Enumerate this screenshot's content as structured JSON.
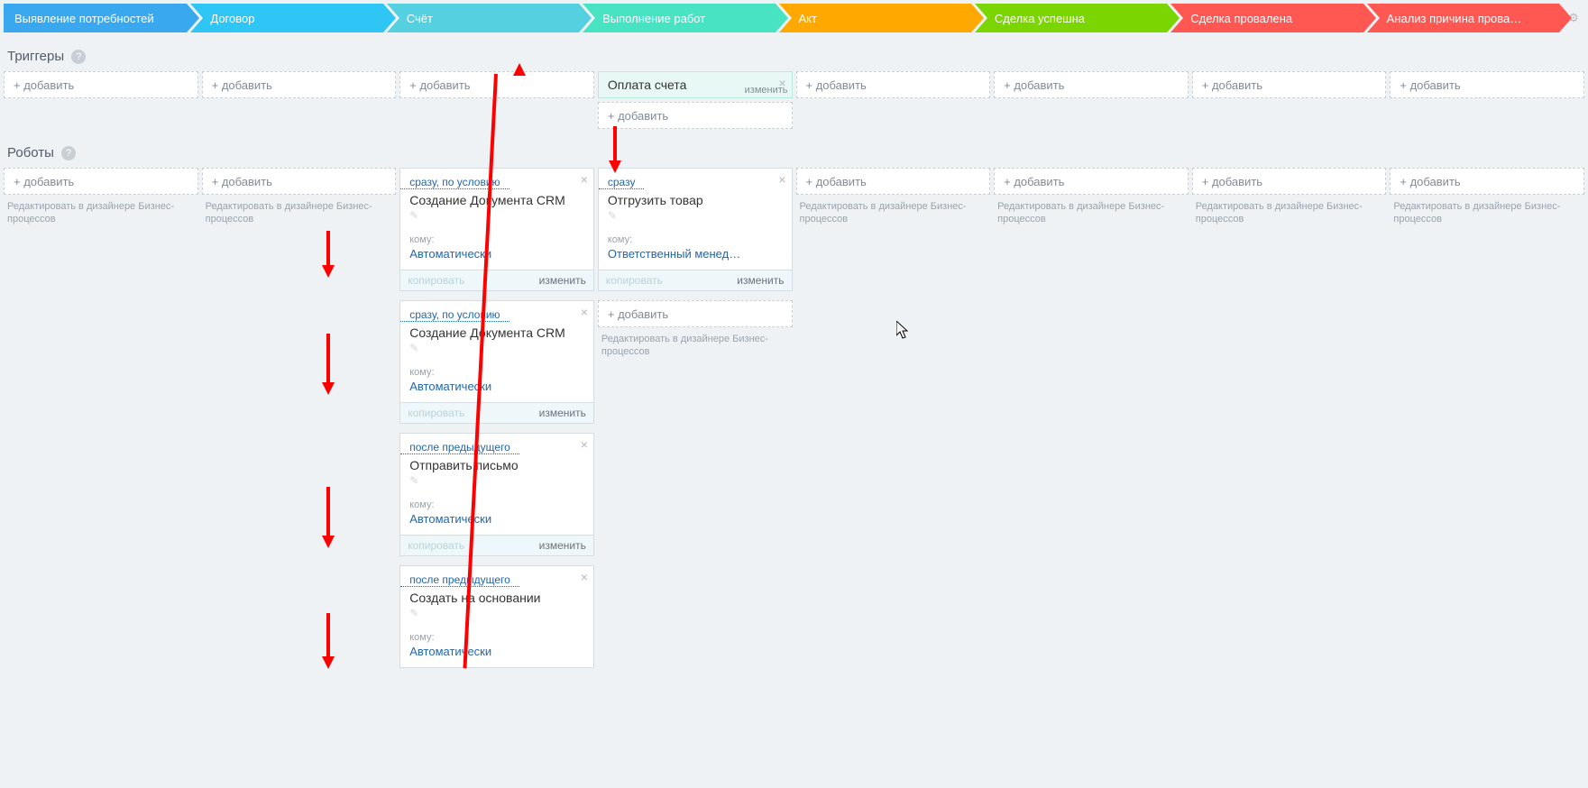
{
  "stages": [
    "Выявление потребностей",
    "Договор",
    "Счёт",
    "Выполнение работ",
    "Акт",
    "Сделка успешна",
    "Сделка провалена",
    "Анализ причина прова…"
  ],
  "labels": {
    "triggers": "Триггеры",
    "robots": "Роботы",
    "add": "+ добавить",
    "bp_edit": "Редактировать в дизайнере Бизнес-процессов",
    "edit": "изменить",
    "copy": "копировать",
    "who": "кому:",
    "auto": "Автоматически"
  },
  "triggers": {
    "col3": {
      "title": "Оплата счета"
    }
  },
  "robots": {
    "col2": [
      {
        "when": "сразу, по условию",
        "title": "Создание Документа CRM",
        "who": "Автоматически"
      },
      {
        "when": "сразу, по условию",
        "title": "Создание Документа CRM",
        "who": "Автоматически"
      },
      {
        "when": "после предыдущего",
        "title": "Отправить письмо",
        "who": "Автоматически"
      },
      {
        "when": "после предыдущего",
        "title": "Создать на основании",
        "who": "Автоматически"
      }
    ],
    "col3": [
      {
        "when": "сразу",
        "title": "Отгрузить товар",
        "who": "Ответственный менед…"
      }
    ]
  }
}
